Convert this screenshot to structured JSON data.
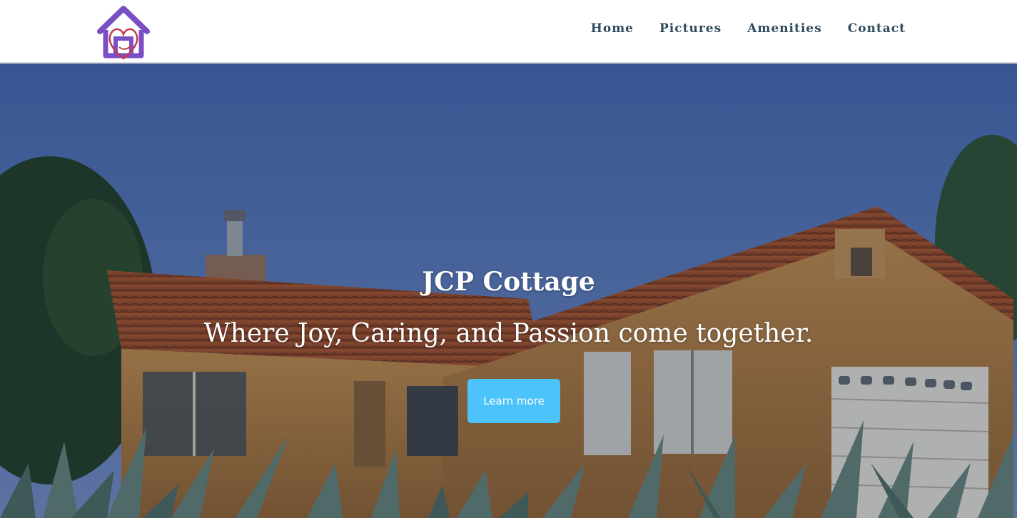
{
  "site": {
    "logo_icon": "house-heart-logo-icon",
    "nav": [
      {
        "label": "Home"
      },
      {
        "label": "Pictures"
      },
      {
        "label": "Amenities"
      },
      {
        "label": "Contact"
      }
    ]
  },
  "hero": {
    "title": "JCP Cottage",
    "subtitle": "Where Joy, Caring, and Passion come together.",
    "cta_label": "Learn more",
    "image_icon": "house-photo-background"
  },
  "colors": {
    "nav_text": "#2e4a5c",
    "cta_bg": "#4cc3fa",
    "logo_purple": "#7b4fc4",
    "logo_red": "#c43a4f"
  }
}
